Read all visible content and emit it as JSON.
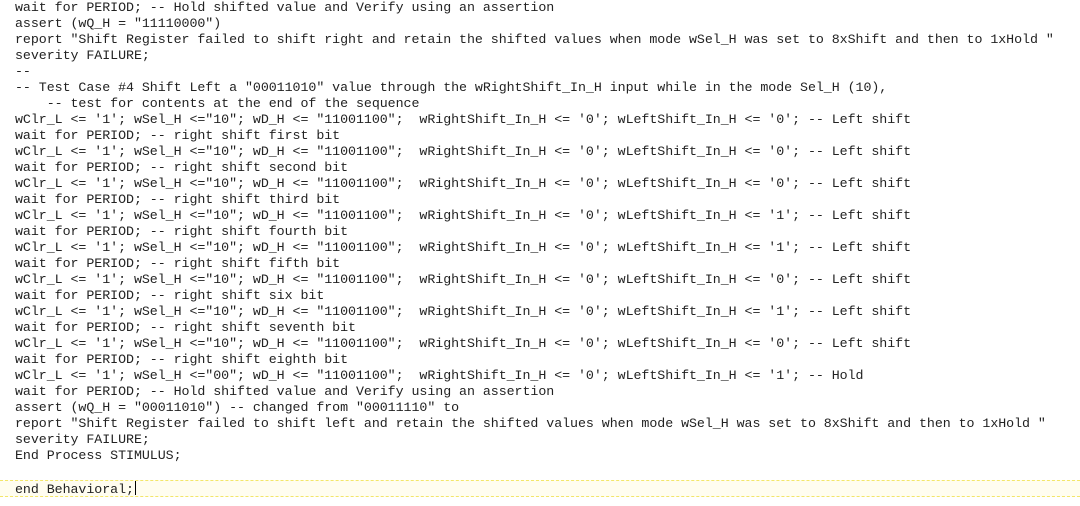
{
  "editor": {
    "lines": [
      "wait for PERIOD; -- Hold shifted value and Verify using an assertion",
      "assert (wQ_H = \"11110000\")",
      "report \"Shift Register failed to shift right and retain the shifted values when mode wSel_H was set to 8xShift and then to 1xHold \"",
      "severity FAILURE;",
      "--",
      "-- Test Case #4 Shift Left a \"00011010\" value through the wRightShift_In_H input while in the mode Sel_H (10),",
      "    -- test for contents at the end of the sequence",
      "wClr_L <= '1'; wSel_H <=\"10\"; wD_H <= \"11001100\";  wRightShift_In_H <= '0'; wLeftShift_In_H <= '0'; -- Left shift",
      "wait for PERIOD; -- right shift first bit",
      "wClr_L <= '1'; wSel_H <=\"10\"; wD_H <= \"11001100\";  wRightShift_In_H <= '0'; wLeftShift_In_H <= '0'; -- Left shift",
      "wait for PERIOD; -- right shift second bit",
      "wClr_L <= '1'; wSel_H <=\"10\"; wD_H <= \"11001100\";  wRightShift_In_H <= '0'; wLeftShift_In_H <= '0'; -- Left shift",
      "wait for PERIOD; -- right shift third bit",
      "wClr_L <= '1'; wSel_H <=\"10\"; wD_H <= \"11001100\";  wRightShift_In_H <= '0'; wLeftShift_In_H <= '1'; -- Left shift",
      "wait for PERIOD; -- right shift fourth bit",
      "wClr_L <= '1'; wSel_H <=\"10\"; wD_H <= \"11001100\";  wRightShift_In_H <= '0'; wLeftShift_In_H <= '1'; -- Left shift",
      "wait for PERIOD; -- right shift fifth bit",
      "wClr_L <= '1'; wSel_H <=\"10\"; wD_H <= \"11001100\";  wRightShift_In_H <= '0'; wLeftShift_In_H <= '0'; -- Left shift",
      "wait for PERIOD; -- right shift six bit",
      "wClr_L <= '1'; wSel_H <=\"10\"; wD_H <= \"11001100\";  wRightShift_In_H <= '0'; wLeftShift_In_H <= '1'; -- Left shift",
      "wait for PERIOD; -- right shift seventh bit",
      "wClr_L <= '1'; wSel_H <=\"10\"; wD_H <= \"11001100\";  wRightShift_In_H <= '0'; wLeftShift_In_H <= '0'; -- Left shift",
      "wait for PERIOD; -- right shift eighth bit",
      "wClr_L <= '1'; wSel_H <=\"00\"; wD_H <= \"11001100\";  wRightShift_In_H <= '0'; wLeftShift_In_H <= '1'; -- Hold",
      "wait for PERIOD; -- Hold shifted value and Verify using an assertion",
      "assert (wQ_H = \"00011010\") -- changed from \"00011110\" to",
      "report \"Shift Register failed to shift left and retain the shifted values when mode wSel_H was set to 8xShift and then to 1xHold \"",
      "severity FAILURE;",
      "End Process STIMULUS;",
      ""
    ],
    "current_line": "end Behavioral;"
  }
}
